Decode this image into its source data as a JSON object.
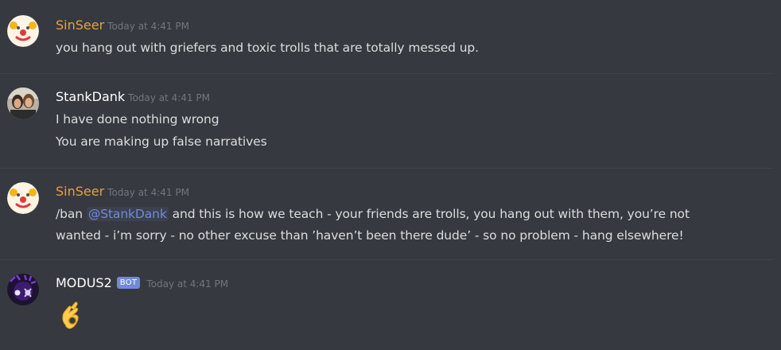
{
  "messages": [
    {
      "author": "SinSeer",
      "author_color": "#e8a13c",
      "timestamp": "Today at 4:41 PM",
      "lines": [
        "you hang out with griefers and toxic trolls that are totally messed up."
      ]
    },
    {
      "author": "StankDank",
      "author_color": "#ffffff",
      "timestamp": "Today at 4:41 PM",
      "lines": [
        "I have done nothing wrong",
        "You are making up false narratives"
      ]
    },
    {
      "author": "SinSeer",
      "author_color": "#e8a13c",
      "timestamp": "Today at 4:41 PM",
      "line1_prefix": "/ban ",
      "mention": "@StankDank",
      "line1_suffix": " and this is how we teach - your friends are trolls, you hang out with them, you’re not",
      "line2": "wanted - i’m sorry - no other excuse than ’haven’t been there dude’ - so no problem - hang elsewhere!"
    },
    {
      "author": "MODUS2",
      "author_color": "#ffffff",
      "bot_tag": "BOT",
      "timestamp": "Today at 4:41 PM",
      "content": "ok-hand-emoji"
    }
  ],
  "icons": {
    "avatar_sinseer": "clown-face-icon",
    "avatar_stankdank": "user-photo-avatar",
    "avatar_modus2": "purple-bot-avatar",
    "ok_hand": "ok-hand-emoji"
  }
}
